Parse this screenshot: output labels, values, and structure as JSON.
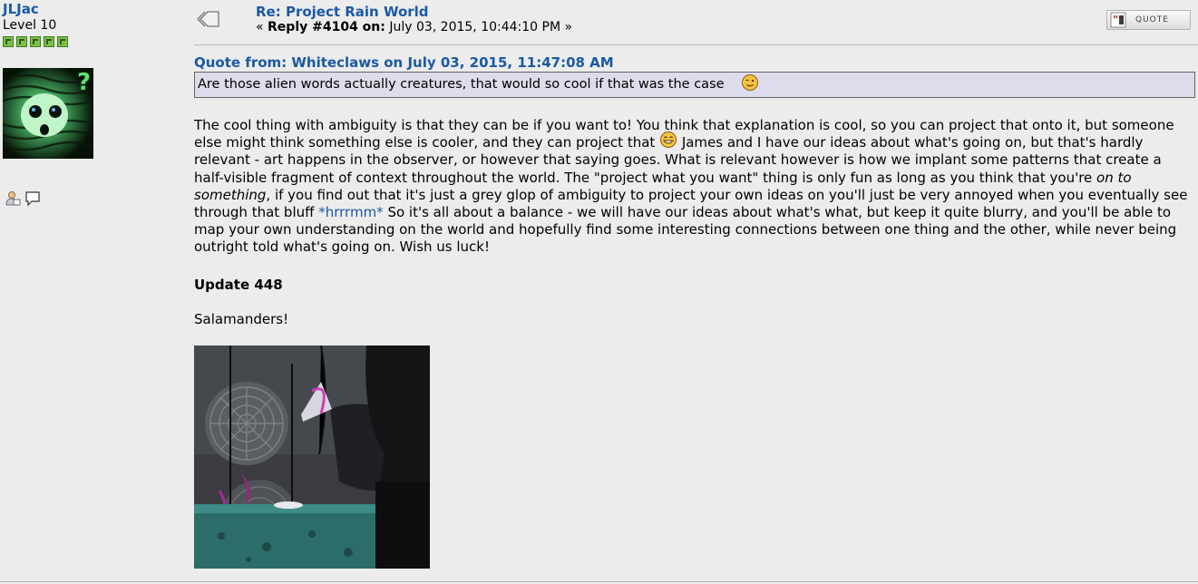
{
  "poster": {
    "name": "JLJac",
    "rank": "Level 10",
    "star_count": 5
  },
  "post": {
    "title": "Re: Project Rain World",
    "meta_prefix": "« ",
    "reply_label": "Reply #4104 on:",
    "date": " July 03, 2015, 10:44:10 PM »",
    "quote_button": "QUOTE"
  },
  "quote": {
    "header": "Quote from: Whiteclaws on July 03, 2015, 11:47:08 AM",
    "text": "Are those alien words actually creatures, that would so cool if that was the case"
  },
  "body": {
    "l1": "The cool thing with ambiguity is that they can be if you want to! You think that explanation is cool, so you can project that onto it, but someone",
    "l2a": "else might think something else is cooler, and they can project that ",
    "l2b": " James and I have our ideas about what's going on, but that's hardly",
    "l3": "relevant - art happens in the observer, or however that saying goes. What is relevant however is how we implant some patterns that create a",
    "l4a": "half-visible fragment of context throughout the world. The \"project what you want\" thing is only fun as long as you think that you're ",
    "l4b": "on to",
    "l5a": "something",
    "l5b": ", if you find out that it's just a grey glop of ambiguity to project your own ideas on you'll just be very annoyed when you eventually see",
    "l6a": "through that bluff ",
    "l6b": "*hrrrmm*",
    "l6c": " So it's all about a balance - we will have our ideas about what's what, but keep it quite blurry, and you'll be able to",
    "l7": "map your own understanding on the world and hopefully find some interesting connections between one thing and the other, while never being",
    "l8": "outright told what's going on. Wish us luck!"
  },
  "update_heading": "Update 448",
  "salamanders": "Salamanders!",
  "colors": {
    "link": "#1b59a4",
    "background": "#ececec",
    "quote_bg": "#dcdcec"
  },
  "icons": {
    "post_icon": "xx-post-icon",
    "profile": "profile-icon",
    "message": "message-icon",
    "quote": "quote-icon"
  }
}
